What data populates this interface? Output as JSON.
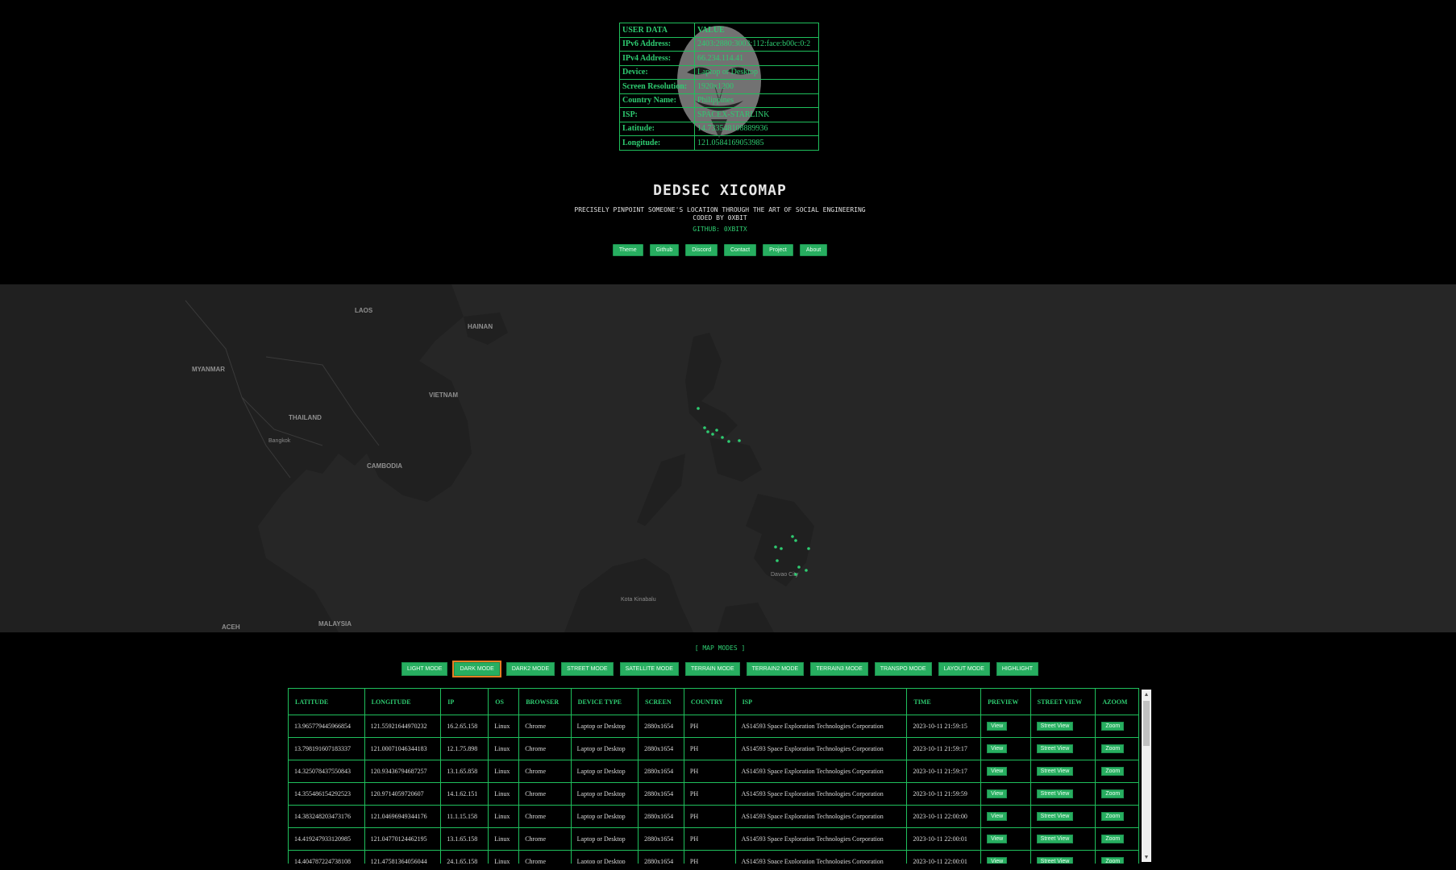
{
  "user_table": {
    "header": {
      "key": "USER DATA",
      "value": "VALUE"
    },
    "rows": [
      {
        "key": "IPv6 Address:",
        "value": "2403:2880:3003:112:face:b00c:0:2"
      },
      {
        "key": "IPv4 Address:",
        "value": "66.234.114.41"
      },
      {
        "key": "Device:",
        "value": "Laptop or Desktop"
      },
      {
        "key": "Screen Resolution:",
        "value": "1920x1200"
      },
      {
        "key": "Country Name:",
        "value": "Philippines"
      },
      {
        "key": "ISP:",
        "value": "SPACEX-STARLINK"
      },
      {
        "key": "Latitude:",
        "value": "14.733548108889936"
      },
      {
        "key": "Longitude:",
        "value": "121.0584169053985"
      }
    ]
  },
  "title": "DEDSEC XICOMAP",
  "tagline": "PRECISELY PINPOINT SOMEONE'S LOCATION THROUGH THE ART OF SOCIAL ENGINEERING",
  "coded_by": "CODED BY 0XBIT",
  "github": "GITHUB: 0XBITX",
  "top_links": [
    "Theme",
    "Github",
    "Discord",
    "Contact",
    "Project",
    "About"
  ],
  "map": {
    "labels": [
      "LAOS",
      "MYANMAR",
      "THAILAND",
      "CAMBODIA",
      "VIETNAM",
      "HAINAN",
      "Bangkok",
      "MALAYSIA",
      "ACEH",
      "Davao City",
      "Kota Kinabalu"
    ],
    "marker_color": "#2ecc71"
  },
  "modes_label": "[ MAP MODES ]",
  "modes": [
    "LIGHT MODE",
    "DARK MODE",
    "DARK2 MODE",
    "STREET MODE",
    "SATELLITE MODE",
    "TERRAIN MODE",
    "TERRAIN2 MODE",
    "TERRAIN3 MODE",
    "TRANSPO MODE",
    "LAYOUT MODE",
    "HIGHLIGHT"
  ],
  "active_mode": "DARK MODE",
  "table": {
    "headers": [
      "LATITUDE",
      "LONGITUDE",
      "IP",
      "OS",
      "BROWSER",
      "DEVICE TYPE",
      "SCREEN",
      "COUNTRY",
      "ISP",
      "TIME",
      "PREVIEW",
      "STREET VIEW",
      "AZOOM"
    ],
    "buttons": {
      "preview": "View",
      "street": "Street View",
      "zoom": "Zoom"
    },
    "rows": [
      [
        "13.965779445966854",
        "121.55921644970232",
        "16.2.65.158",
        "Linux",
        "Chrome",
        "Laptop or Desktop",
        "2880x1654",
        "PH",
        "AS14593 Space Exploration Technologies Corporation",
        "2023-10-11 21:59:15"
      ],
      [
        "13.798191607183337",
        "121.00071046344183",
        "12.1.75.898",
        "Linux",
        "Chrome",
        "Laptop or Desktop",
        "2880x1654",
        "PH",
        "AS14593 Space Exploration Technologies Corporation",
        "2023-10-11 21:59:17"
      ],
      [
        "14.325078437550843",
        "120.93436794687257",
        "13.1.65.858",
        "Linux",
        "Chrome",
        "Laptop or Desktop",
        "2880x1654",
        "PH",
        "AS14593 Space Exploration Technologies Corporation",
        "2023-10-11 21:59:17"
      ],
      [
        "14.355486154292523",
        "120.9714059720607",
        "14.1.62.151",
        "Linux",
        "Chrome",
        "Laptop or Desktop",
        "2880x1654",
        "PH",
        "AS14593 Space Exploration Technologies Corporation",
        "2023-10-11 21:59:59"
      ],
      [
        "14.383248203473176",
        "121.04696949344176",
        "11.1.15.158",
        "Linux",
        "Chrome",
        "Laptop or Desktop",
        "2880x1654",
        "PH",
        "AS14593 Space Exploration Technologies Corporation",
        "2023-10-11 22:00:00"
      ],
      [
        "14.419247933120985",
        "121.04770124462195",
        "13.1.65.158",
        "Linux",
        "Chrome",
        "Laptop or Desktop",
        "2880x1654",
        "PH",
        "AS14593 Space Exploration Technologies Corporation",
        "2023-10-11 22:00:01"
      ],
      [
        "14.404787224738108",
        "121.47581364056044",
        "24.1.65.158",
        "Linux",
        "Chrome",
        "Laptop or Desktop",
        "2880x1654",
        "PH",
        "AS14593 Space Exploration Technologies Corporation",
        "2023-10-11 22:00:01"
      ]
    ]
  }
}
